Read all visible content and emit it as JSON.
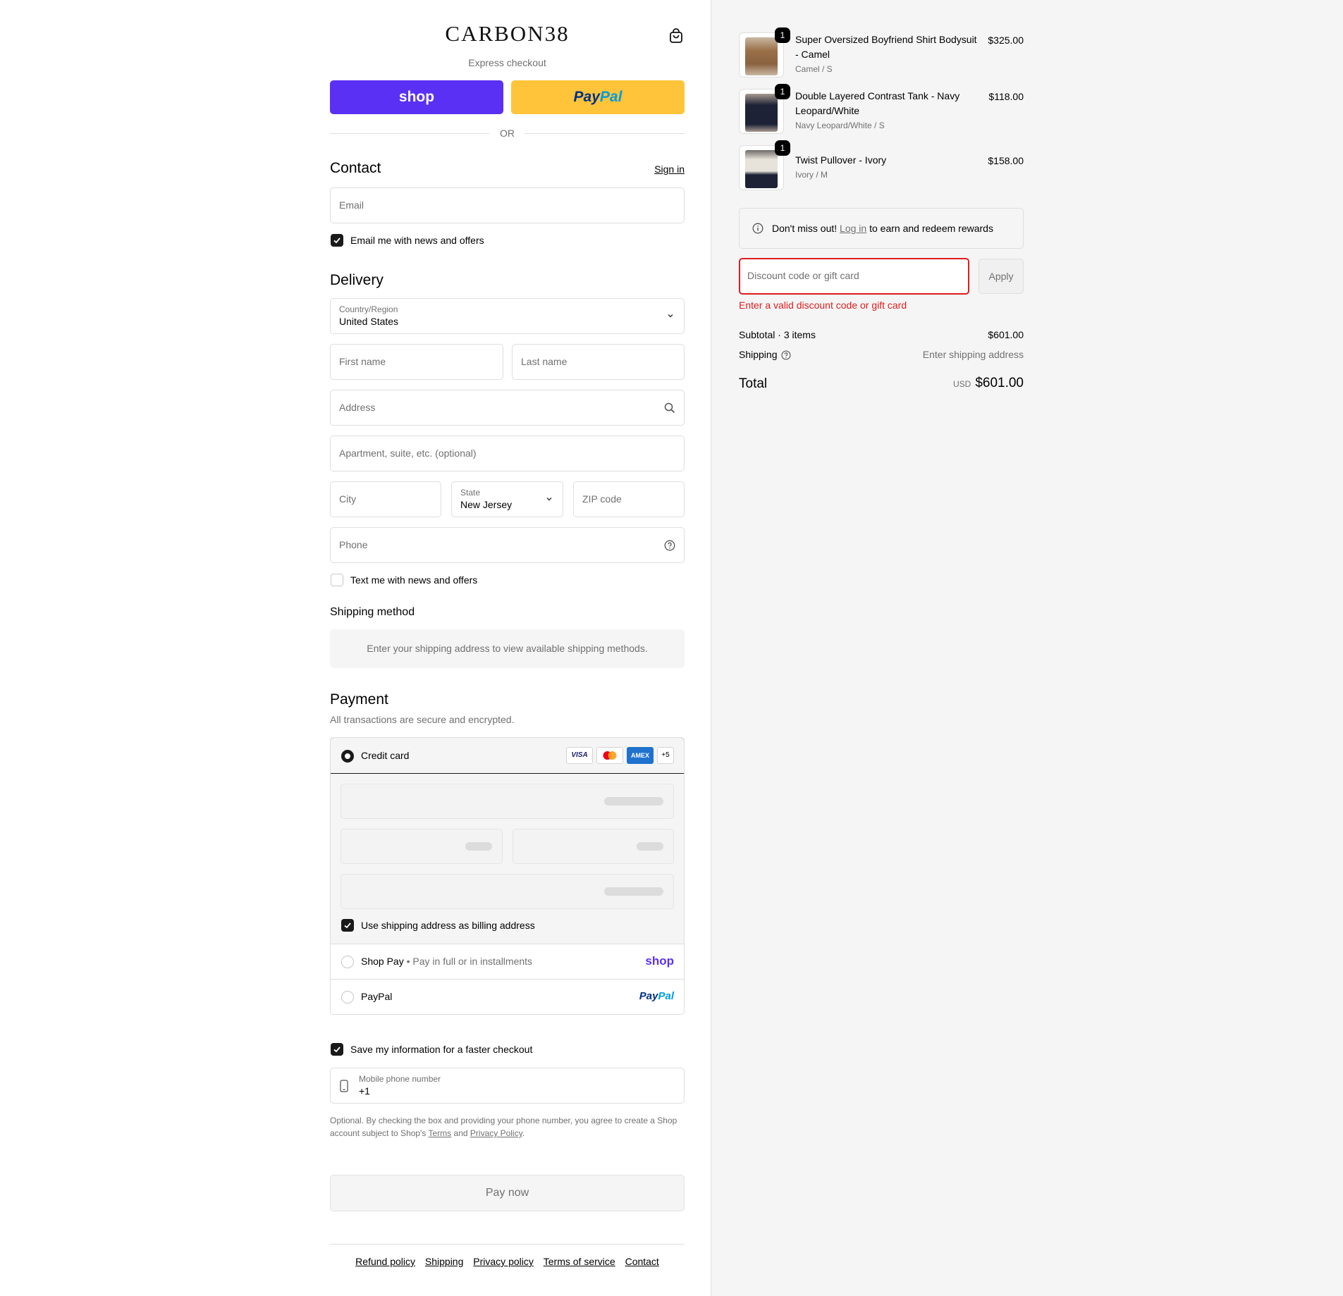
{
  "brand": {
    "logo_text": "CARBON38"
  },
  "express": {
    "label": "Express checkout",
    "shop_label": "shop",
    "paypal_label_1": "Pay",
    "paypal_label_2": "Pal",
    "or_label": "OR"
  },
  "contact": {
    "heading": "Contact",
    "sign_in": "Sign in",
    "email_placeholder": "Email",
    "news_label": "Email me with news and offers",
    "news_checked": true
  },
  "delivery": {
    "heading": "Delivery",
    "country_label": "Country/Region",
    "country_value": "United States",
    "first_name_placeholder": "First name",
    "last_name_placeholder": "Last name",
    "address_placeholder": "Address",
    "apartment_placeholder": "Apartment, suite, etc. (optional)",
    "city_placeholder": "City",
    "state_label": "State",
    "state_value": "New Jersey",
    "zip_placeholder": "ZIP code",
    "phone_placeholder": "Phone",
    "text_label": "Text me with news and offers",
    "text_checked": false
  },
  "shipping_method": {
    "heading": "Shipping method",
    "message": "Enter your shipping address to view available shipping methods."
  },
  "payment": {
    "heading": "Payment",
    "subtitle": "All transactions are secure and encrypted.",
    "credit_card_label": "Credit card",
    "card_logos": [
      "VISA",
      "mastercard",
      "AMEX"
    ],
    "more_cards": "+5",
    "billing_label": "Use shipping address as billing address",
    "shop_pay_label": "Shop Pay",
    "shop_pay_bullet": "•",
    "shop_pay_sub": "Pay in full or in installments",
    "shop_pay_logo": "shop",
    "paypal_label": "PayPal",
    "paypal_logo_1": "Pay",
    "paypal_logo_2": "Pal"
  },
  "save_info": {
    "label": "Save my information for a faster checkout",
    "checked": true,
    "mobile_label": "Mobile phone number",
    "mobile_value": "+1",
    "legal_1": "Optional. By checking the box and providing your phone number, you agree to create a Shop",
    "legal_2": "account subject to Shop's",
    "terms": "Terms",
    "and": "and",
    "privacy": "Privacy Policy",
    "period": "."
  },
  "pay_now": "Pay now",
  "footer_links": [
    "Refund policy",
    "Shipping",
    "Privacy policy",
    "Terms of service",
    "Contact"
  ],
  "order": {
    "items": [
      {
        "qty": "1",
        "name_1": "Super Oversized Boyfriend Shirt Bodysuit",
        "name_2": "- Camel",
        "variant": "Camel / S",
        "price": "$325.00",
        "color": "#9a7048"
      },
      {
        "qty": "1",
        "name_1": "Double Layered Contrast Tank - Navy",
        "name_2": "Leopard/White",
        "variant": "Navy Leopard/White / S",
        "price": "$118.00",
        "color": "#1d2236"
      },
      {
        "qty": "1",
        "name_1": "Twist Pullover - Ivory",
        "name_2": "",
        "variant": "Ivory / M",
        "price": "$158.00",
        "color": "#e8e3da"
      }
    ],
    "rewards_pre": "Don't miss out!",
    "rewards_link": "Log in",
    "rewards_post": "to earn and redeem rewards",
    "discount_placeholder": "Discount code or gift card",
    "apply_label": "Apply",
    "discount_error": "Enter a valid discount code or gift card",
    "subtotal_label": "Subtotal · 3 items",
    "subtotal_value": "$601.00",
    "shipping_label": "Shipping",
    "shipping_value": "Enter shipping address",
    "total_label": "Total",
    "total_currency": "USD",
    "total_value": "$601.00"
  },
  "colors": {
    "shop_purple": "#5a31f4",
    "paypal_yellow": "#ffc439",
    "error_red": "#dd1d1d"
  }
}
